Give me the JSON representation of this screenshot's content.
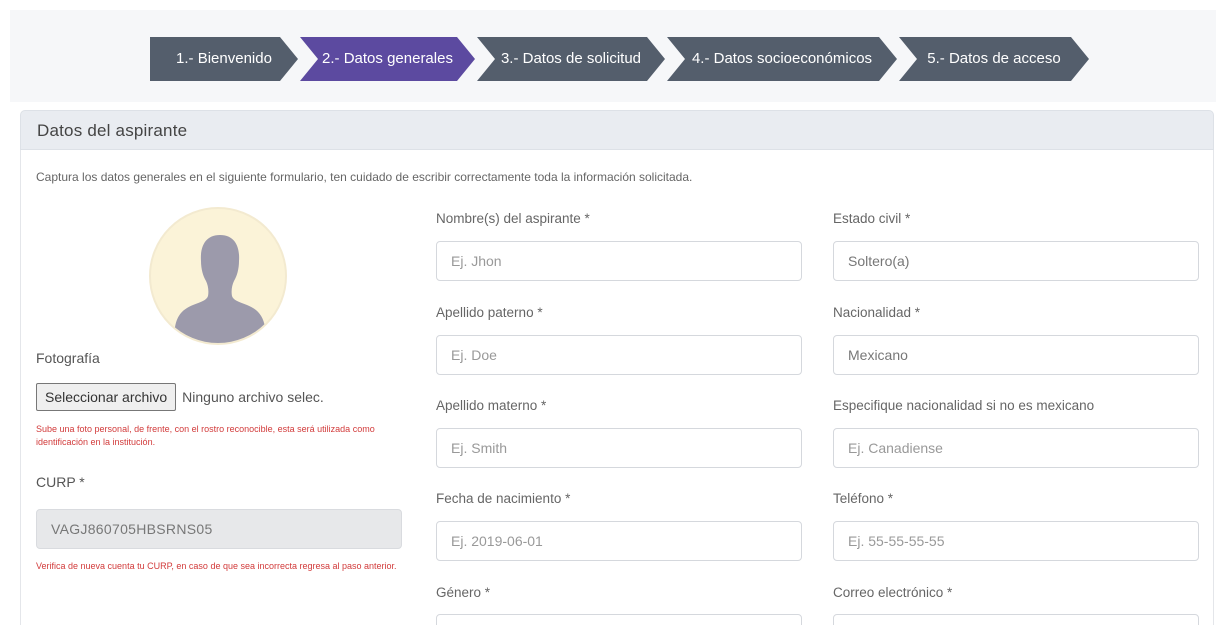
{
  "stepper": {
    "steps": [
      {
        "label": "1.- Bienvenido",
        "active": false
      },
      {
        "label": "2.- Datos generales",
        "active": true
      },
      {
        "label": "3.- Datos de solicitud",
        "active": false
      },
      {
        "label": "4.- Datos socioeconómicos",
        "active": false
      },
      {
        "label": "5.- Datos de acceso",
        "active": false
      }
    ]
  },
  "panel": {
    "title": "Datos del aspirante",
    "intro": "Captura los datos generales en el siguiente formulario, ten cuidado de escribir correctamente toda la información solicitada."
  },
  "photo": {
    "label": "Fotografía",
    "button": "Seleccionar archivo",
    "file_status": "Ninguno archivo selec.",
    "hint": "Sube una foto personal, de frente, con el rostro reconocible, esta será utilizada como identificación en la institución."
  },
  "curp": {
    "label": "CURP *",
    "value": "VAGJ860705HBSRNS05",
    "hint": "Verifica de nueva cuenta tu CURP, en caso de que sea incorrecta regresa al paso anterior."
  },
  "form": {
    "nombre": {
      "label": "Nombre(s) del aspirante *",
      "placeholder": "Ej. Jhon"
    },
    "apellido_paterno": {
      "label": "Apellido paterno *",
      "placeholder": "Ej. Doe"
    },
    "apellido_materno": {
      "label": "Apellido materno *",
      "placeholder": "Ej. Smith"
    },
    "fecha_nacimiento": {
      "label": "Fecha de nacimiento *",
      "placeholder": "Ej. 2019-06-01"
    },
    "genero": {
      "label": "Género *"
    },
    "estado_civil": {
      "label": "Estado civil *",
      "value": "Soltero(a)"
    },
    "nacionalidad": {
      "label": "Nacionalidad *",
      "value": "Mexicano"
    },
    "especifique": {
      "label": "Especifique nacionalidad si no es mexicano",
      "placeholder": "Ej. Canadiense"
    },
    "telefono": {
      "label": "Teléfono *",
      "placeholder": "Ej. 55-55-55-55"
    },
    "correo": {
      "label": "Correo electrónico *"
    }
  },
  "colors": {
    "step_active": "#5c4aa0",
    "step_inactive": "#545e6c",
    "hint_red": "#d23b3b"
  }
}
